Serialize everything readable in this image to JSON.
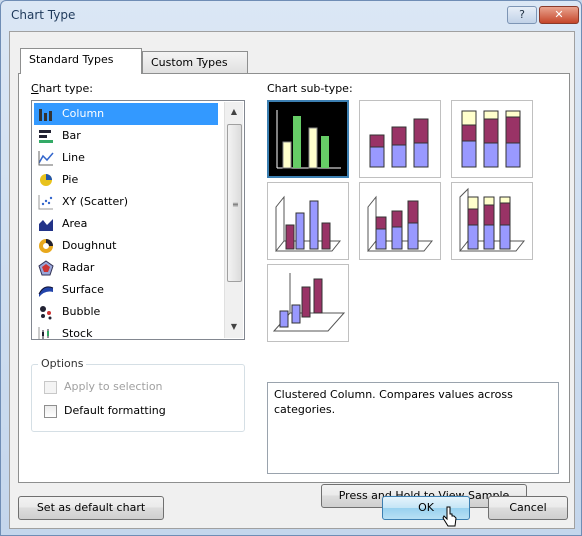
{
  "window": {
    "title": "Chart Type",
    "help_label": "?",
    "close_label": "✕"
  },
  "tabs": [
    {
      "label": "Standard Types",
      "active": true
    },
    {
      "label": "Custom Types",
      "active": false
    }
  ],
  "chart_type": {
    "label": "Chart type:",
    "items": [
      {
        "label": "Column",
        "icon": "column-chart-icon",
        "selected": true
      },
      {
        "label": "Bar",
        "icon": "bar-chart-icon"
      },
      {
        "label": "Line",
        "icon": "line-chart-icon"
      },
      {
        "label": "Pie",
        "icon": "pie-chart-icon"
      },
      {
        "label": "XY (Scatter)",
        "icon": "scatter-chart-icon"
      },
      {
        "label": "Area",
        "icon": "area-chart-icon"
      },
      {
        "label": "Doughnut",
        "icon": "doughnut-chart-icon"
      },
      {
        "label": "Radar",
        "icon": "radar-chart-icon"
      },
      {
        "label": "Surface",
        "icon": "surface-chart-icon"
      },
      {
        "label": "Bubble",
        "icon": "bubble-chart-icon"
      },
      {
        "label": "Stock",
        "icon": "stock-chart-icon"
      }
    ]
  },
  "options": {
    "label": "Options",
    "apply_to_selection": {
      "label": "Apply to selection",
      "checked": false,
      "enabled": false
    },
    "default_formatting": {
      "label": "Default formatting",
      "checked": false,
      "enabled": true
    }
  },
  "sub_type": {
    "label": "Chart sub-type:",
    "selected_index": 0,
    "description": "Clustered Column. Compares values across categories."
  },
  "buttons": {
    "press_and_hold": "Press and Hold to View Sample",
    "set_default": "Set as default chart",
    "ok": "OK",
    "cancel": "Cancel"
  },
  "colors": {
    "selection": "#3399ff",
    "series_purple": "#9999ff",
    "series_maroon": "#993366",
    "series_cream": "#ffffcc",
    "series_green": "#66cc66"
  }
}
